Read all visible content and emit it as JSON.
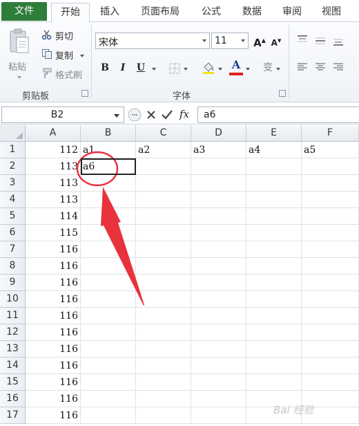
{
  "ribbon_tabs": [
    "文件",
    "开始",
    "插入",
    "页面布局",
    "公式",
    "数据",
    "审阅",
    "视图"
  ],
  "active_tab": "开始",
  "clipboard": {
    "paste_label": "粘贴",
    "cut_label": "剪切",
    "copy_label": "复制",
    "format_painter_label": "格式刷",
    "group_label": "剪贴板"
  },
  "font": {
    "name": "宋体",
    "size": "11",
    "group_label": "字体",
    "bold": "B",
    "italic": "I",
    "underline": "U",
    "grow": "A",
    "shrink": "A",
    "font_color": "A",
    "phonetic": "变"
  },
  "formula_bar": {
    "name_box": "B2",
    "fx_label": "fx",
    "content": "a6"
  },
  "columns": [
    "A",
    "B",
    "C",
    "D",
    "E",
    "F"
  ],
  "rows": [
    {
      "num": "1",
      "A": "112",
      "B": "a1",
      "C": "a2",
      "D": "a3",
      "E": "a4",
      "F": "a5"
    },
    {
      "num": "2",
      "A": "113",
      "B": "a6",
      "C": "",
      "D": "",
      "E": "",
      "F": ""
    },
    {
      "num": "3",
      "A": "113",
      "B": "",
      "C": "",
      "D": "",
      "E": "",
      "F": ""
    },
    {
      "num": "4",
      "A": "113",
      "B": "",
      "C": "",
      "D": "",
      "E": "",
      "F": ""
    },
    {
      "num": "5",
      "A": "114",
      "B": "",
      "C": "",
      "D": "",
      "E": "",
      "F": ""
    },
    {
      "num": "6",
      "A": "115",
      "B": "",
      "C": "",
      "D": "",
      "E": "",
      "F": ""
    },
    {
      "num": "7",
      "A": "116",
      "B": "",
      "C": "",
      "D": "",
      "E": "",
      "F": ""
    },
    {
      "num": "8",
      "A": "116",
      "B": "",
      "C": "",
      "D": "",
      "E": "",
      "F": ""
    },
    {
      "num": "9",
      "A": "116",
      "B": "",
      "C": "",
      "D": "",
      "E": "",
      "F": ""
    },
    {
      "num": "10",
      "A": "116",
      "B": "",
      "C": "",
      "D": "",
      "E": "",
      "F": ""
    },
    {
      "num": "11",
      "A": "116",
      "B": "",
      "C": "",
      "D": "",
      "E": "",
      "F": ""
    },
    {
      "num": "12",
      "A": "116",
      "B": "",
      "C": "",
      "D": "",
      "E": "",
      "F": ""
    },
    {
      "num": "13",
      "A": "116",
      "B": "",
      "C": "",
      "D": "",
      "E": "",
      "F": ""
    },
    {
      "num": "14",
      "A": "116",
      "B": "",
      "C": "",
      "D": "",
      "E": "",
      "F": ""
    },
    {
      "num": "15",
      "A": "116",
      "B": "",
      "C": "",
      "D": "",
      "E": "",
      "F": ""
    },
    {
      "num": "16",
      "A": "116",
      "B": "",
      "C": "",
      "D": "",
      "E": "",
      "F": ""
    },
    {
      "num": "17",
      "A": "116",
      "B": "",
      "C": "",
      "D": "",
      "E": "",
      "F": ""
    }
  ],
  "selected_cell": "B2",
  "colors": {
    "file_tab": "#2f7d3a",
    "annotation": "#e8323c",
    "font_color_bar": "#e02020",
    "highlight_bar": "#f5e400"
  },
  "watermark": "Bai 经验"
}
